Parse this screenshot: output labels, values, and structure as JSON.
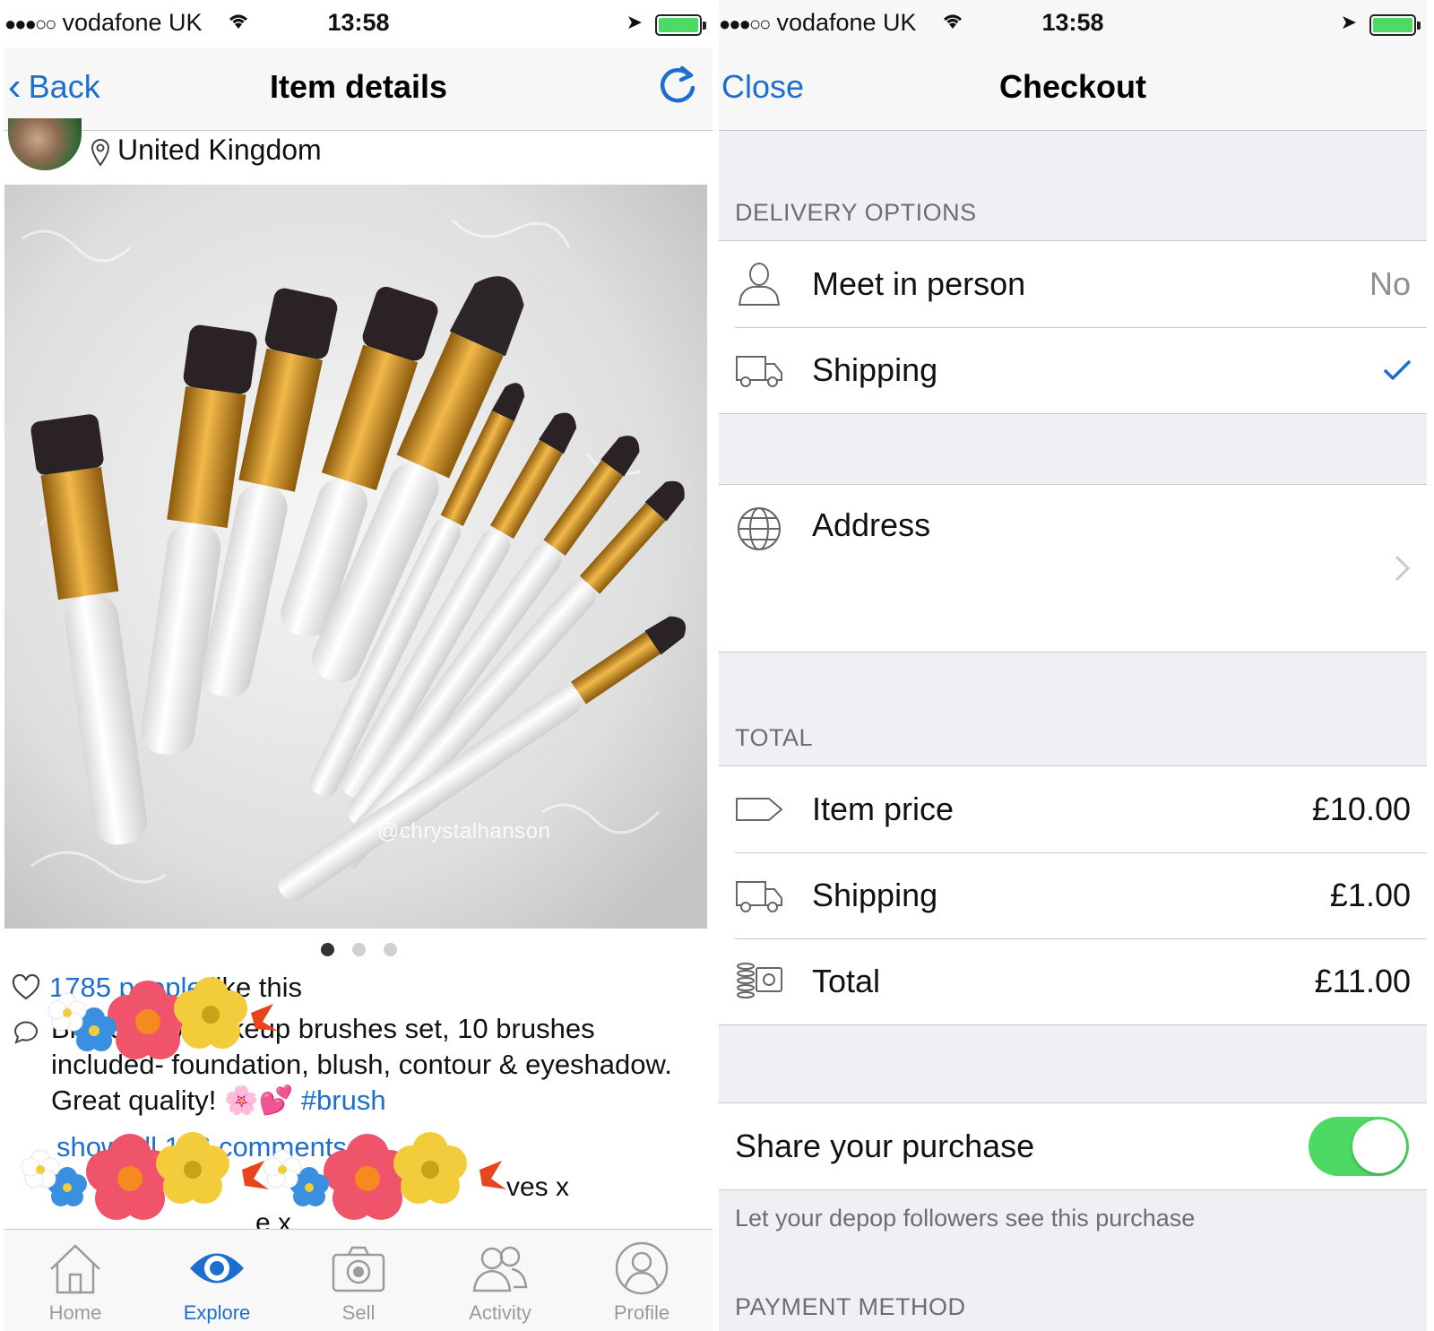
{
  "left": {
    "status": {
      "carrier": "vodafone UK",
      "time": "13:58"
    },
    "nav": {
      "back_label": "Back",
      "title": "Item details"
    },
    "seller": {
      "location": "United Kingdom"
    },
    "photo": {
      "watermark": "@chrystalhanson",
      "page_count": 3,
      "active_page": 1
    },
    "likes": {
      "count_text": "1785 people",
      "suffix": "like this"
    },
    "description": {
      "text": "Brand new makeup brushes set, 10 brushes included- foundation, blush, contour & eyeshadow. Great quality! 🌸💕",
      "hashtag": "#brush"
    },
    "comments": {
      "show_all": "show all 156 comments...",
      "partial_1": "ves x",
      "partial_2": "e x"
    },
    "tabs": [
      {
        "label": "Home",
        "icon": "home-icon"
      },
      {
        "label": "Explore",
        "icon": "eye-icon",
        "active": true
      },
      {
        "label": "Sell",
        "icon": "camera-icon"
      },
      {
        "label": "Activity",
        "icon": "people-icon"
      },
      {
        "label": "Profile",
        "icon": "profile-icon"
      }
    ],
    "accent": "#1d6fcf"
  },
  "right": {
    "status": {
      "carrier": "vodafone UK",
      "time": "13:58"
    },
    "nav": {
      "close_label": "Close",
      "title": "Checkout"
    },
    "delivery": {
      "header": "DELIVERY OPTIONS",
      "meet": {
        "label": "Meet in person",
        "value": "No",
        "icon": "person-icon"
      },
      "shipping": {
        "label": "Shipping",
        "selected": true,
        "icon": "truck-icon"
      }
    },
    "address": {
      "label": "Address",
      "icon": "globe-icon"
    },
    "total": {
      "header": "TOTAL",
      "item_price": {
        "label": "Item price",
        "value": "£10.00",
        "icon": "tag-icon"
      },
      "shipping": {
        "label": "Shipping",
        "value": "£1.00",
        "icon": "truck-icon"
      },
      "total": {
        "label": "Total",
        "value": "£11.00",
        "icon": "money-icon"
      }
    },
    "share": {
      "label": "Share your purchase",
      "enabled": true,
      "note": "Let your depop followers see this purchase"
    },
    "payment": {
      "header": "PAYMENT METHOD"
    },
    "toggle_color": "#4cd964"
  }
}
